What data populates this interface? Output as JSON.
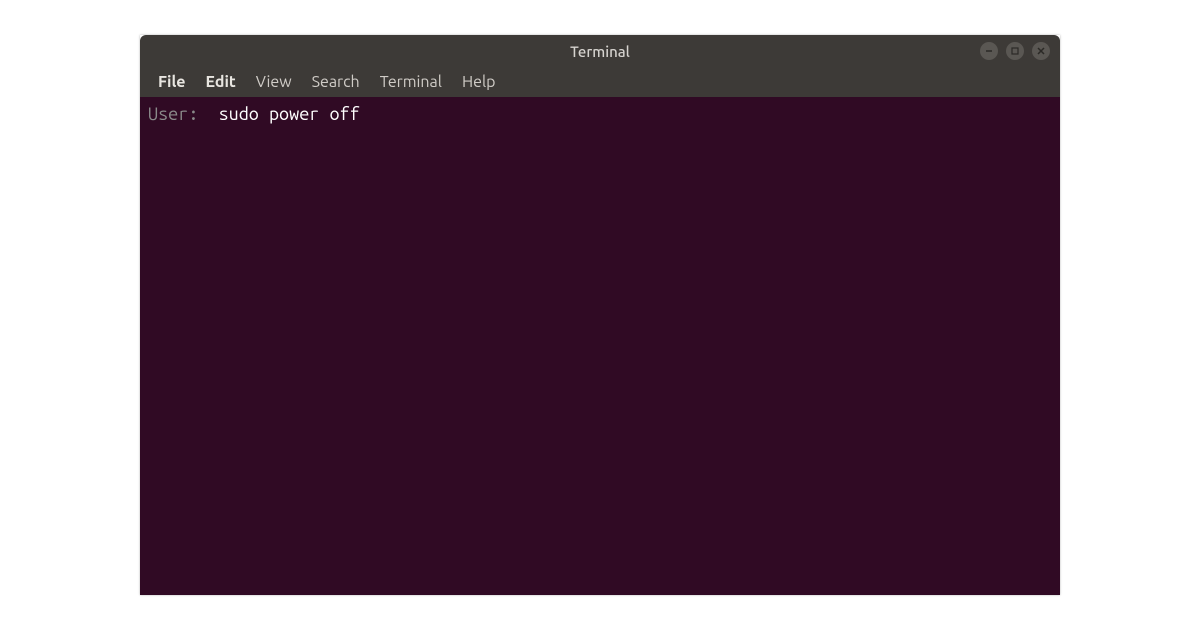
{
  "titlebar": {
    "title": "Terminal"
  },
  "menubar": {
    "items": [
      {
        "label": "File",
        "bold": true
      },
      {
        "label": "Edit",
        "bold": true
      },
      {
        "label": "View",
        "bold": false
      },
      {
        "label": "Search",
        "bold": false
      },
      {
        "label": "Terminal",
        "bold": false
      },
      {
        "label": "Help",
        "bold": false
      }
    ]
  },
  "terminal": {
    "prompt": "User:  ",
    "command": "sudo power off"
  },
  "colors": {
    "titlebar_bg": "#3d3a37",
    "terminal_bg": "#300a24",
    "prompt_fg": "#8a8a8a",
    "command_fg": "#ffffff"
  }
}
